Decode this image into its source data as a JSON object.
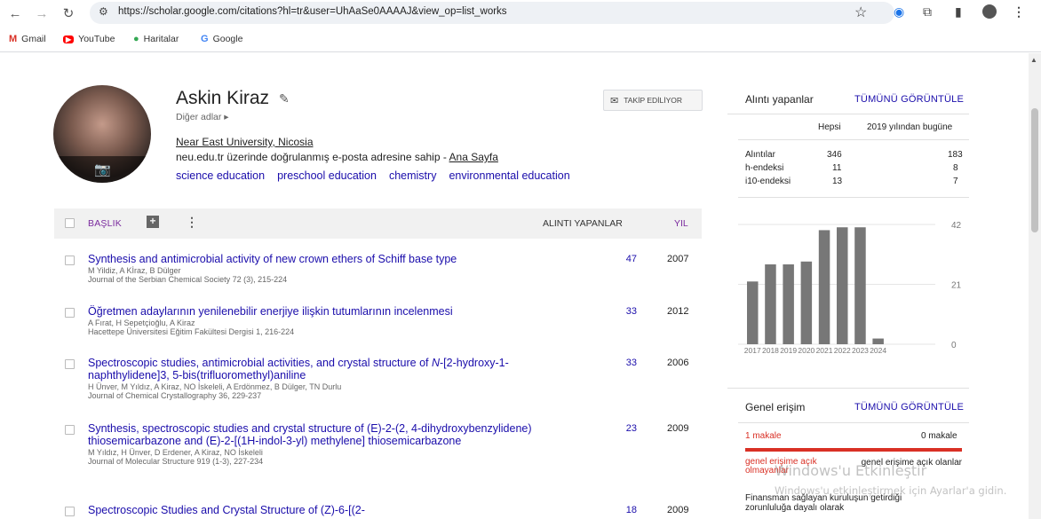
{
  "browser": {
    "url": "https://scholar.google.com/citations?hl=tr&user=UhAaSe0AAAAJ&view_op=list_works"
  },
  "bookmarks": [
    {
      "label": "Gmail",
      "icon": "gmail-icon",
      "color": "#d93025"
    },
    {
      "label": "YouTube",
      "icon": "youtube-icon",
      "color": "#ff0000"
    },
    {
      "label": "Haritalar",
      "icon": "maps-icon",
      "color": "#34a853"
    },
    {
      "label": "Google",
      "icon": "google-icon",
      "color": "#4285f4"
    }
  ],
  "profile": {
    "name": "Askin Kiraz",
    "other_names": "Diğer adlar ▸",
    "affiliation": "Near East University, Nicosia",
    "email_text": "neu.edu.tr üzerinde doğrulanmış e-posta adresine sahip - ",
    "homepage": "Ana Sayfa",
    "interests": [
      "science education",
      "preschool education",
      "chemistry",
      "environmental education"
    ],
    "follow_label": "TAKİP EDİLİYOR"
  },
  "table": {
    "title_header": "BAŞLIK",
    "cited_header": "ALINTI YAPANLAR",
    "year_header": "YIL"
  },
  "articles": [
    {
      "title": "Synthesis and antimicrobial activity of new crown ethers of Schiff base type",
      "authors": "M Yildiz, A Kİraz, B Dülger",
      "venue": "Journal of the Serbian Chemical Society 72 (3), 215-224",
      "cited": "47",
      "year": "2007"
    },
    {
      "title": "Öğretmen adaylarının yenilenebilir enerjiye ilişkin tutumlarının incelenmesi",
      "authors": "A Fırat, H Sepetçioğlu, A Kiraz",
      "venue": "Hacettepe Üniversitesi Eğitim Fakültesi Dergisi 1, 216-224",
      "cited": "33",
      "year": "2012"
    },
    {
      "title": "Spectroscopic studies, antimicrobial activities, and crystal structure of N-[2-hydroxy-1-naphthylidene]3, 5-bis(trifluoromethyl)aniline",
      "authors": "H Ünver, M Yıldız, A Kiraz, NO İskeleli, A Erdönmez, B Dülger, TN Durlu",
      "venue": "Journal of Chemical Crystallography 36, 229-237",
      "cited": "33",
      "year": "2006"
    },
    {
      "title": "Synthesis, spectroscopic studies and crystal structure of (E)-2-(2, 4-dihydroxybenzylidene) thiosemicarbazone and (E)-2-[(1H-indol-3-yl) methylene] thiosemicarbazone",
      "authors": "M Yıldız, H Ünver, D Erdener, A Kiraz, NO İskeleli",
      "venue": "Journal of Molecular Structure 919 (1-3), 227-234",
      "cited": "23",
      "year": "2009"
    },
    {
      "title": "Spectroscopic Studies and Crystal Structure of (Z)-6-[(2-",
      "authors": "",
      "venue": "",
      "cited": "18",
      "year": "2009"
    }
  ],
  "cited_by": {
    "title": "Alıntı yapanlar",
    "view_all": "TÜMÜNÜ GÖRÜNTÜLE",
    "col_all": "Hepsi",
    "col_since": "2019 yılından bugüne",
    "rows": [
      {
        "label": "Alıntılar",
        "all": "346",
        "since": "183"
      },
      {
        "label": "h-endeksi",
        "all": "11",
        "since": "8"
      },
      {
        "label": "i10-endeksi",
        "all": "13",
        "since": "7"
      }
    ]
  },
  "chart_data": {
    "type": "bar",
    "categories": [
      "2017",
      "2018",
      "2019",
      "2020",
      "2021",
      "2022",
      "2023",
      "2024"
    ],
    "values": [
      22,
      28,
      28,
      29,
      40,
      41,
      41,
      2
    ],
    "ylim": [
      0,
      42
    ],
    "yticks": [
      0,
      21,
      42
    ],
    "color": "#777777"
  },
  "public_access": {
    "title": "Genel erişim",
    "view_all": "TÜMÜNÜ GÖRÜNTÜLE",
    "left_count": "1 makale",
    "right_count": "0 makale",
    "left_label": "genel erişime açık olmayanlar",
    "right_label": "genel erişime açık olanlar",
    "mandate": "Finansman sağlayan kuruluşun getirdiği zorunluluğa dayalı olarak"
  },
  "watermark": {
    "line1": "Windows'u Etkinleştir",
    "line2": "Windows'u etkinleştirmek için Ayarlar'a gidin."
  }
}
